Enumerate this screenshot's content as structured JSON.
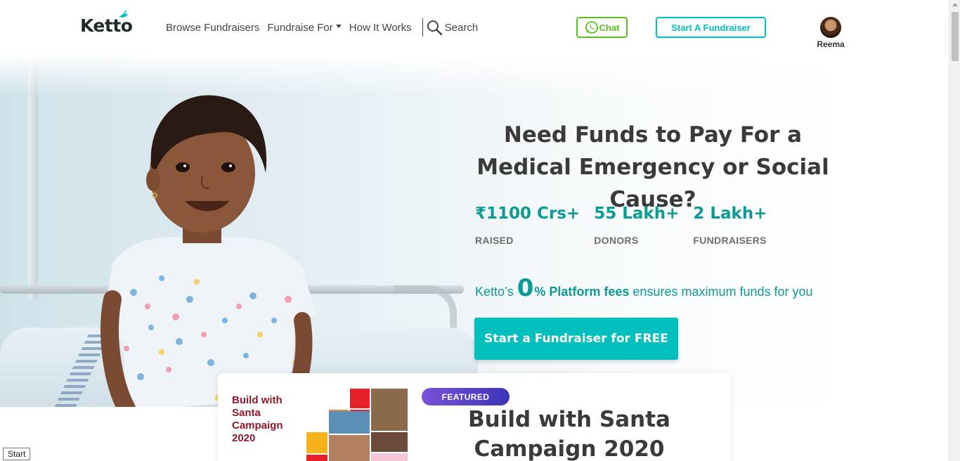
{
  "header": {
    "logo": "Ketto",
    "nav": {
      "browse": "Browse Fundraisers",
      "fundraise_for": "Fundraise For",
      "how_it_works": "How It Works",
      "search": "Search"
    },
    "chat_label": "Chat",
    "start_fundraiser_label": "Start A Fundraiser",
    "user_name": "Reema"
  },
  "hero": {
    "headline": "Need Funds to Pay For a Medical Emergency or Social Cause?",
    "stats": [
      {
        "value": "₹1100 Crs+",
        "label": "RAISED"
      },
      {
        "value": "55 Lakh+",
        "label": "DONORS"
      },
      {
        "value": "2 Lakh+",
        "label": "FUNDRAISERS"
      }
    ],
    "fees": {
      "prefix": "Ketto’s",
      "zero": "0",
      "percent_bold": "% Platform fees",
      "suffix": "ensures maximum funds for you"
    },
    "cta_label": "Start a Fundraiser for FREE"
  },
  "featured": {
    "badge": "FEATURED",
    "image_title": "Build with Santa Campaign 2020",
    "title": "Build with Santa Campaign 2020"
  },
  "status": {
    "start_tooltip": "Start"
  },
  "colors": {
    "teal": "#01bfbd",
    "teal_dark": "#0c9a96",
    "whatsapp_green": "#5ac21e",
    "featured_purple": "#5a43c8",
    "heading": "#3a3a3a"
  }
}
